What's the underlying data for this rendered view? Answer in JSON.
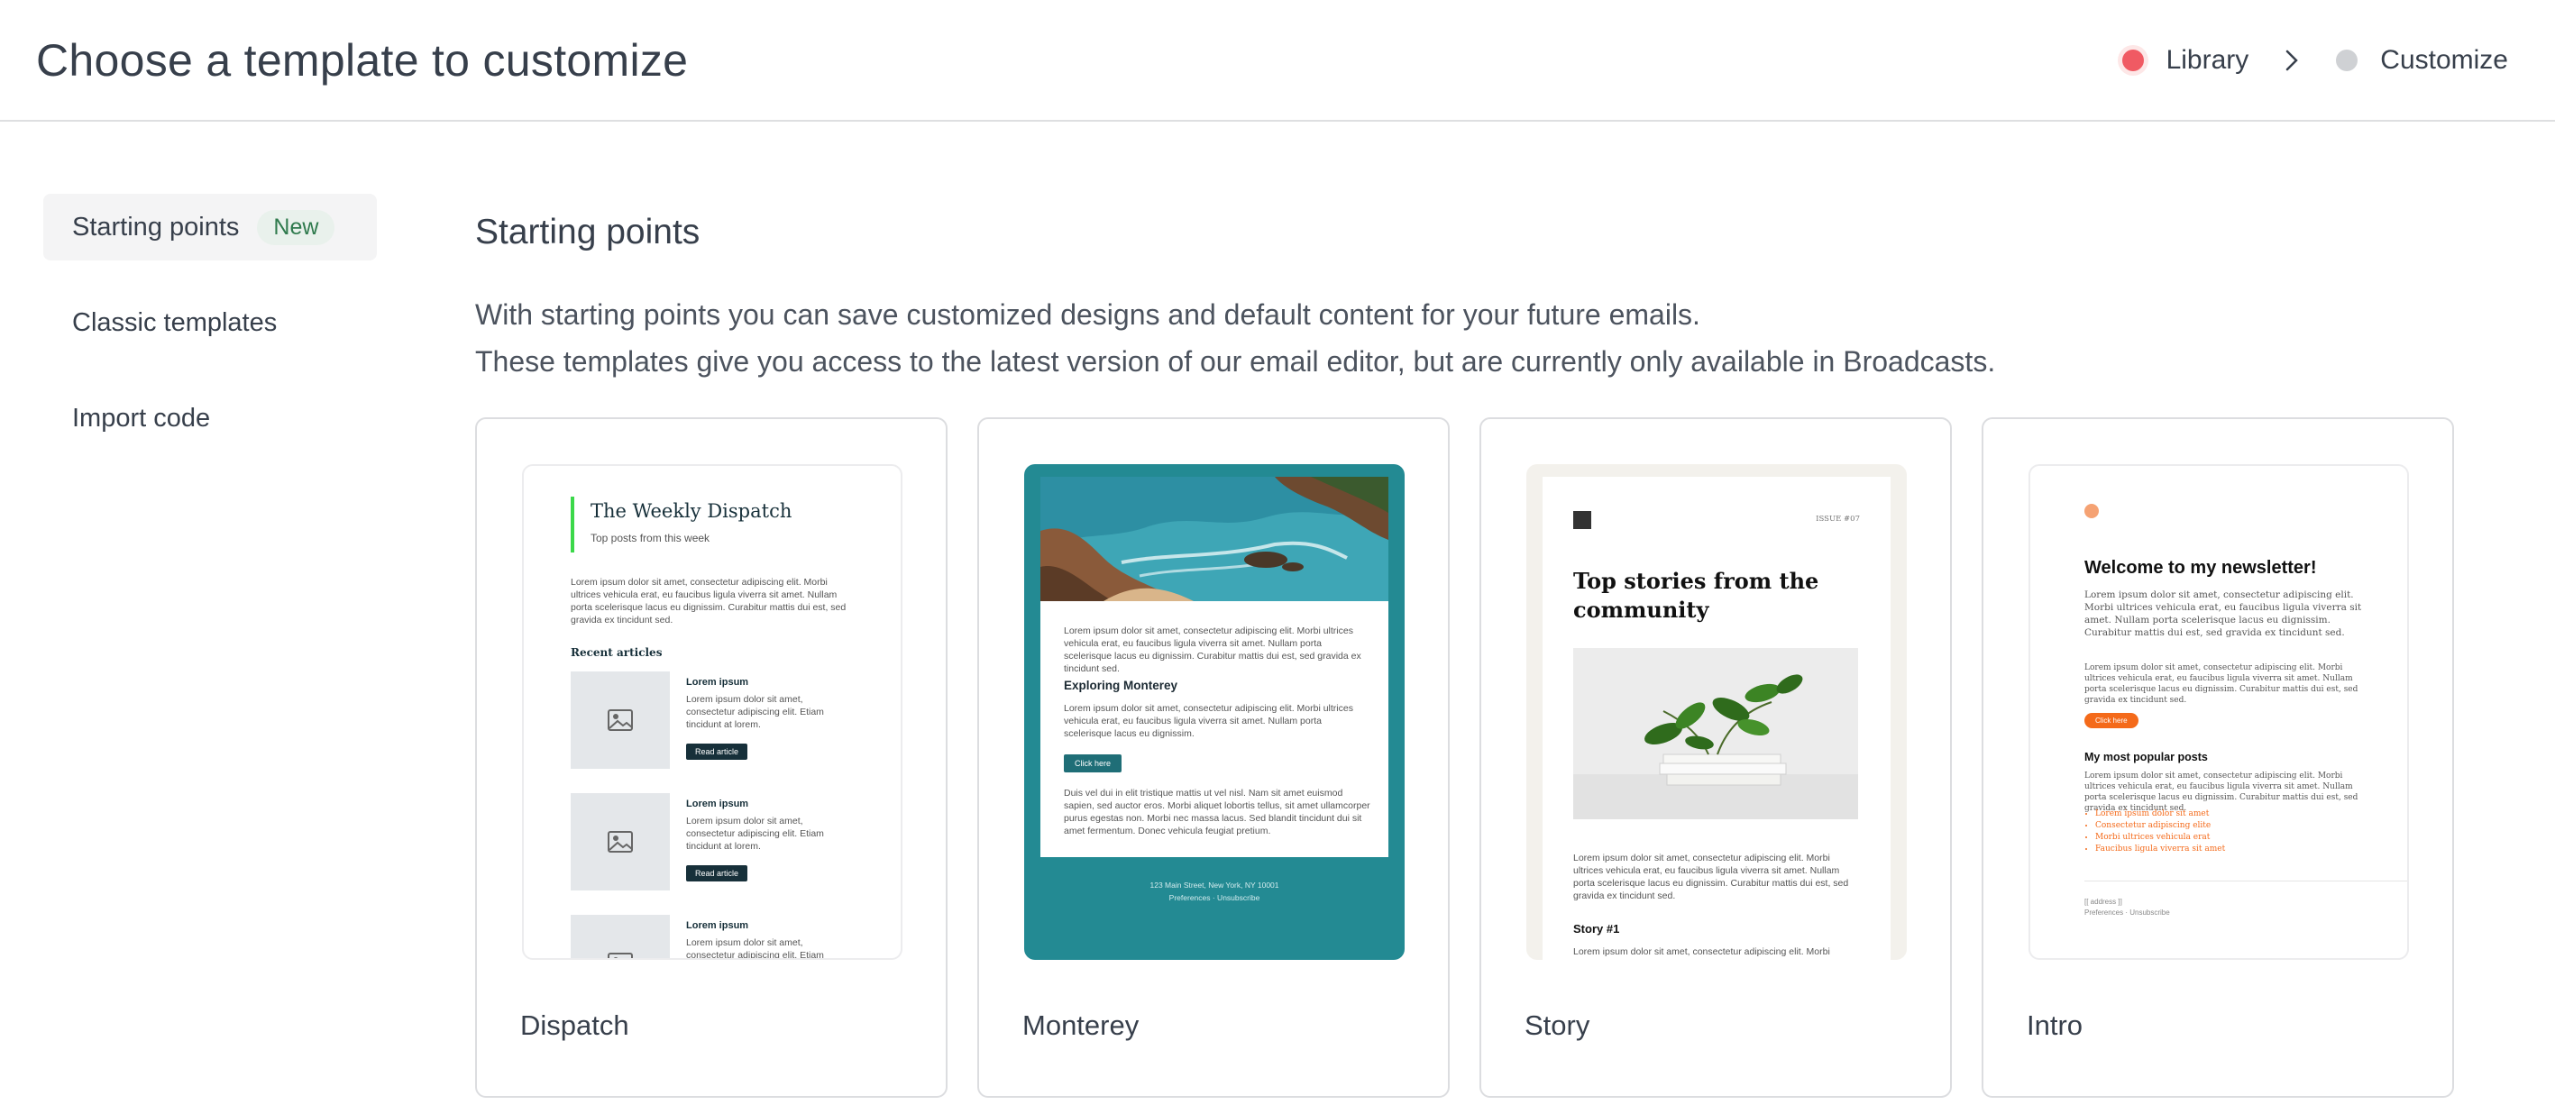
{
  "header": {
    "title": "Choose a template to customize",
    "steps": [
      {
        "label": "Library",
        "state": "active",
        "color": "#f05a63"
      },
      {
        "label": "Customize",
        "state": "inactive",
        "color": "#cfd1d4"
      }
    ]
  },
  "sidebar": {
    "items": [
      {
        "label": "Starting points",
        "badge": "New",
        "active": true
      },
      {
        "label": "Classic templates",
        "active": false
      },
      {
        "label": "Import code",
        "active": false
      }
    ]
  },
  "main": {
    "title": "Starting points",
    "description_line1": "With starting points you can save customized designs and default content for your future emails.",
    "description_line2": "These templates give you access to the latest version of our email editor, but are currently only available in Broadcasts.",
    "cards": [
      {
        "name": "Dispatch",
        "preview": {
          "title": "The Weekly Dispatch",
          "subtitle": "Top posts from this week",
          "intro": "Lorem ipsum dolor sit amet, consectetur adipiscing elit. Morbi ultrices vehicula erat, eu faucibus ligula viverra sit amet. Nullam porta scelerisque lacus eu dignissim. Curabitur mattis dui est, sed gravida ex tincidunt sed.",
          "recent_heading": "Recent articles",
          "article_title": "Lorem ipsum",
          "article_body": "Lorem ipsum dolor sit amet, consectetur adipiscing elit. Etiam tincidunt at lorem.",
          "article_body_partial": "Lorem ipsum dolor sit amet, consectetur adipiscing elit. Etiam",
          "button": "Read article"
        }
      },
      {
        "name": "Monterey",
        "preview": {
          "p1": "Lorem ipsum dolor sit amet, consectetur adipiscing elit. Morbi ultrices vehicula erat, eu faucibus ligula viverra sit amet. Nullam porta scelerisque lacus eu dignissim. Curabitur mattis dui est, sed gravida ex tincidunt sed.",
          "heading": "Exploring Monterey",
          "p2": "Lorem ipsum dolor sit amet, consectetur adipiscing elit. Morbi ultrices vehicula erat, eu faucibus ligula viverra sit amet. Nullam porta scelerisque lacus eu dignissim.",
          "button": "Click here",
          "p3": "Duis vel dui in elit tristique mattis ut vel nisl. Nam sit amet euismod sapien, sed auctor eros. Morbi aliquet lobortis tellus, sit amet ullamcorper purus egestas non. Morbi nec massa lacus. Sed blandit tincidunt dui sit amet fermentum. Donec vehicula feugiat pretium.",
          "address": "123 Main Street, New York, NY 10001",
          "footer_links": "Preferences · Unsubscribe"
        }
      },
      {
        "name": "Story",
        "preview": {
          "issue": "ISSUE #07",
          "heading": "Top stories from the community",
          "p1": "Lorem ipsum dolor sit amet, consectetur adipiscing elit. Morbi ultrices vehicula erat, eu faucibus ligula viverra sit amet. Nullam porta scelerisque lacus eu dignissim. Curabitur mattis dui est, sed gravida ex tincidunt sed.",
          "story_title": "Story #1",
          "p2": "Lorem ipsum dolor sit amet, consectetur adipiscing elit. Morbi"
        }
      },
      {
        "name": "Intro",
        "preview": {
          "heading": "Welcome to my newsletter!",
          "p1": "Lorem ipsum dolor sit amet, consectetur adipiscing elit. Morbi ultrices vehicula erat, eu faucibus ligula viverra sit amet. Nullam porta scelerisque lacus eu dignissim. Curabitur mattis dui est, sed gravida ex tincidunt sed.",
          "p2": "Lorem ipsum dolor sit amet, consectetur adipiscing elit. Morbi ultrices vehicula erat, eu faucibus ligula viverra sit amet. Nullam porta scelerisque lacus eu dignissim. Curabitur mattis dui est, sed gravida ex tincidunt sed.",
          "button": "Click here",
          "popular_heading": "My most popular posts",
          "p3": "Lorem ipsum dolor sit amet, consectetur adipiscing elit. Morbi ultrices vehicula erat, eu faucibus ligula viverra sit amet. Nullam porta scelerisque lacus eu dignissim. Curabitur mattis dui est, sed gravida ex tincidunt sed.",
          "list": [
            "Lorem ipsum dolor sit amet",
            "Consectetur adipiscing elite",
            "Morbi ultrices vehicula erat",
            "Faucibus ligula viverra sit amet"
          ],
          "footer_address": "[[ address ]]",
          "footer_links": "Preferences · Unsubscribe"
        }
      }
    ]
  },
  "colors": {
    "accent_red": "#f05a63",
    "badge_green": "#2f7a4d",
    "monterey_teal": "#238a93",
    "intro_orange": "#f46a1a"
  }
}
